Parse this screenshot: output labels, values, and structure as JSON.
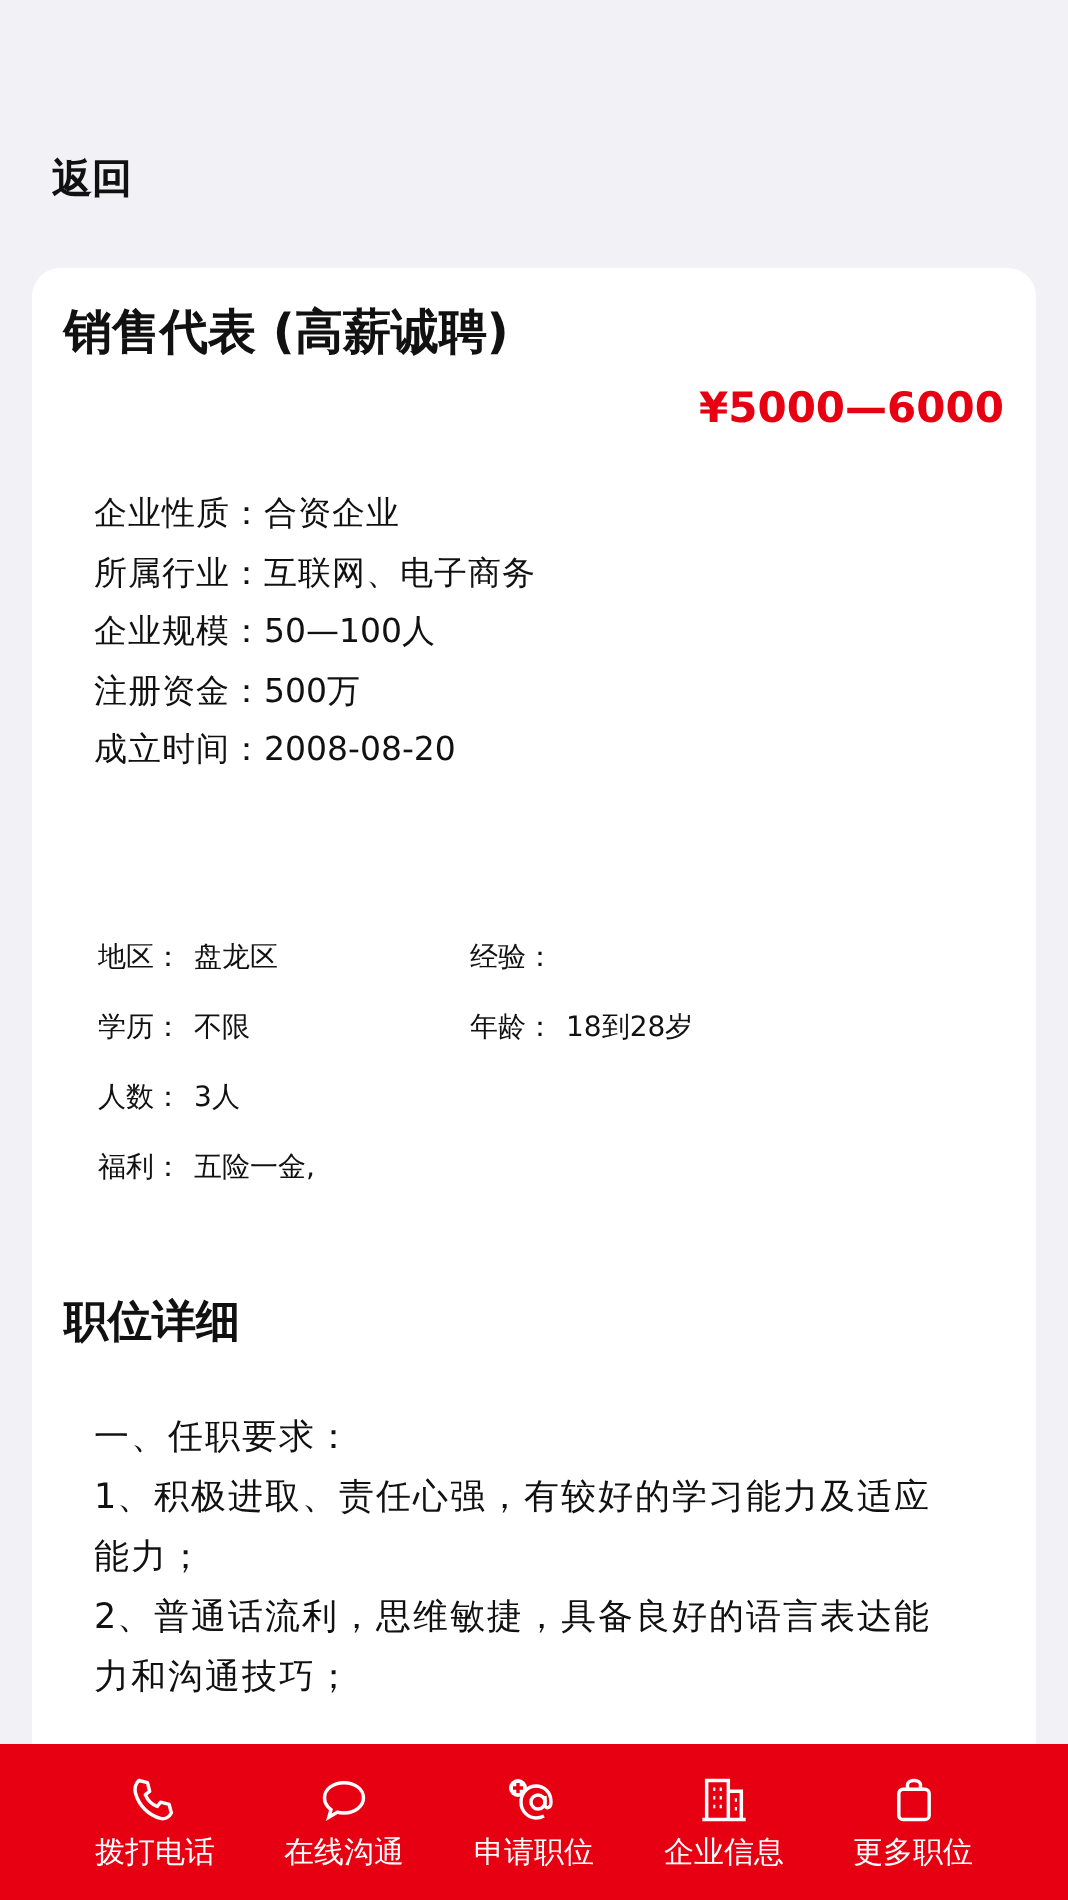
{
  "back": "返回",
  "job": {
    "title": "销售代表 (高薪诚聘)",
    "salary": "¥5000—6000"
  },
  "company": [
    {
      "label": "企业性质：",
      "value": "合资企业"
    },
    {
      "label": "所属行业：",
      "value": "互联网、电子商务"
    },
    {
      "label": "企业规模：",
      "value": "50—100人"
    },
    {
      "label": "注册资金：",
      "value": "500万"
    },
    {
      "label": "成立时间：",
      "value": "2008-08-20"
    }
  ],
  "facts": [
    [
      {
        "label": "地区：",
        "value": "盘龙区"
      },
      {
        "label": "经验："
      }
    ],
    [
      {
        "label": "学历：",
        "value": "不限"
      },
      {
        "label": "年龄：",
        "value": "18到28岁"
      }
    ],
    [
      {
        "label": "人数：",
        "value": "3人"
      }
    ],
    [
      {
        "label": "福利：",
        "value": "五险一金,"
      }
    ]
  ],
  "details": {
    "heading": "职位详细",
    "lines": [
      "一、任职要求：",
      "1、积极进取、责任心强，有较好的学习能力及适应能力；",
      "2、普通话流利，思维敏捷，具备良好的语言表达能力和沟通技巧；"
    ]
  },
  "bottom_bar": [
    "拨打电话",
    "在线沟通",
    "申请职位",
    "企业信息",
    "更多职位"
  ]
}
